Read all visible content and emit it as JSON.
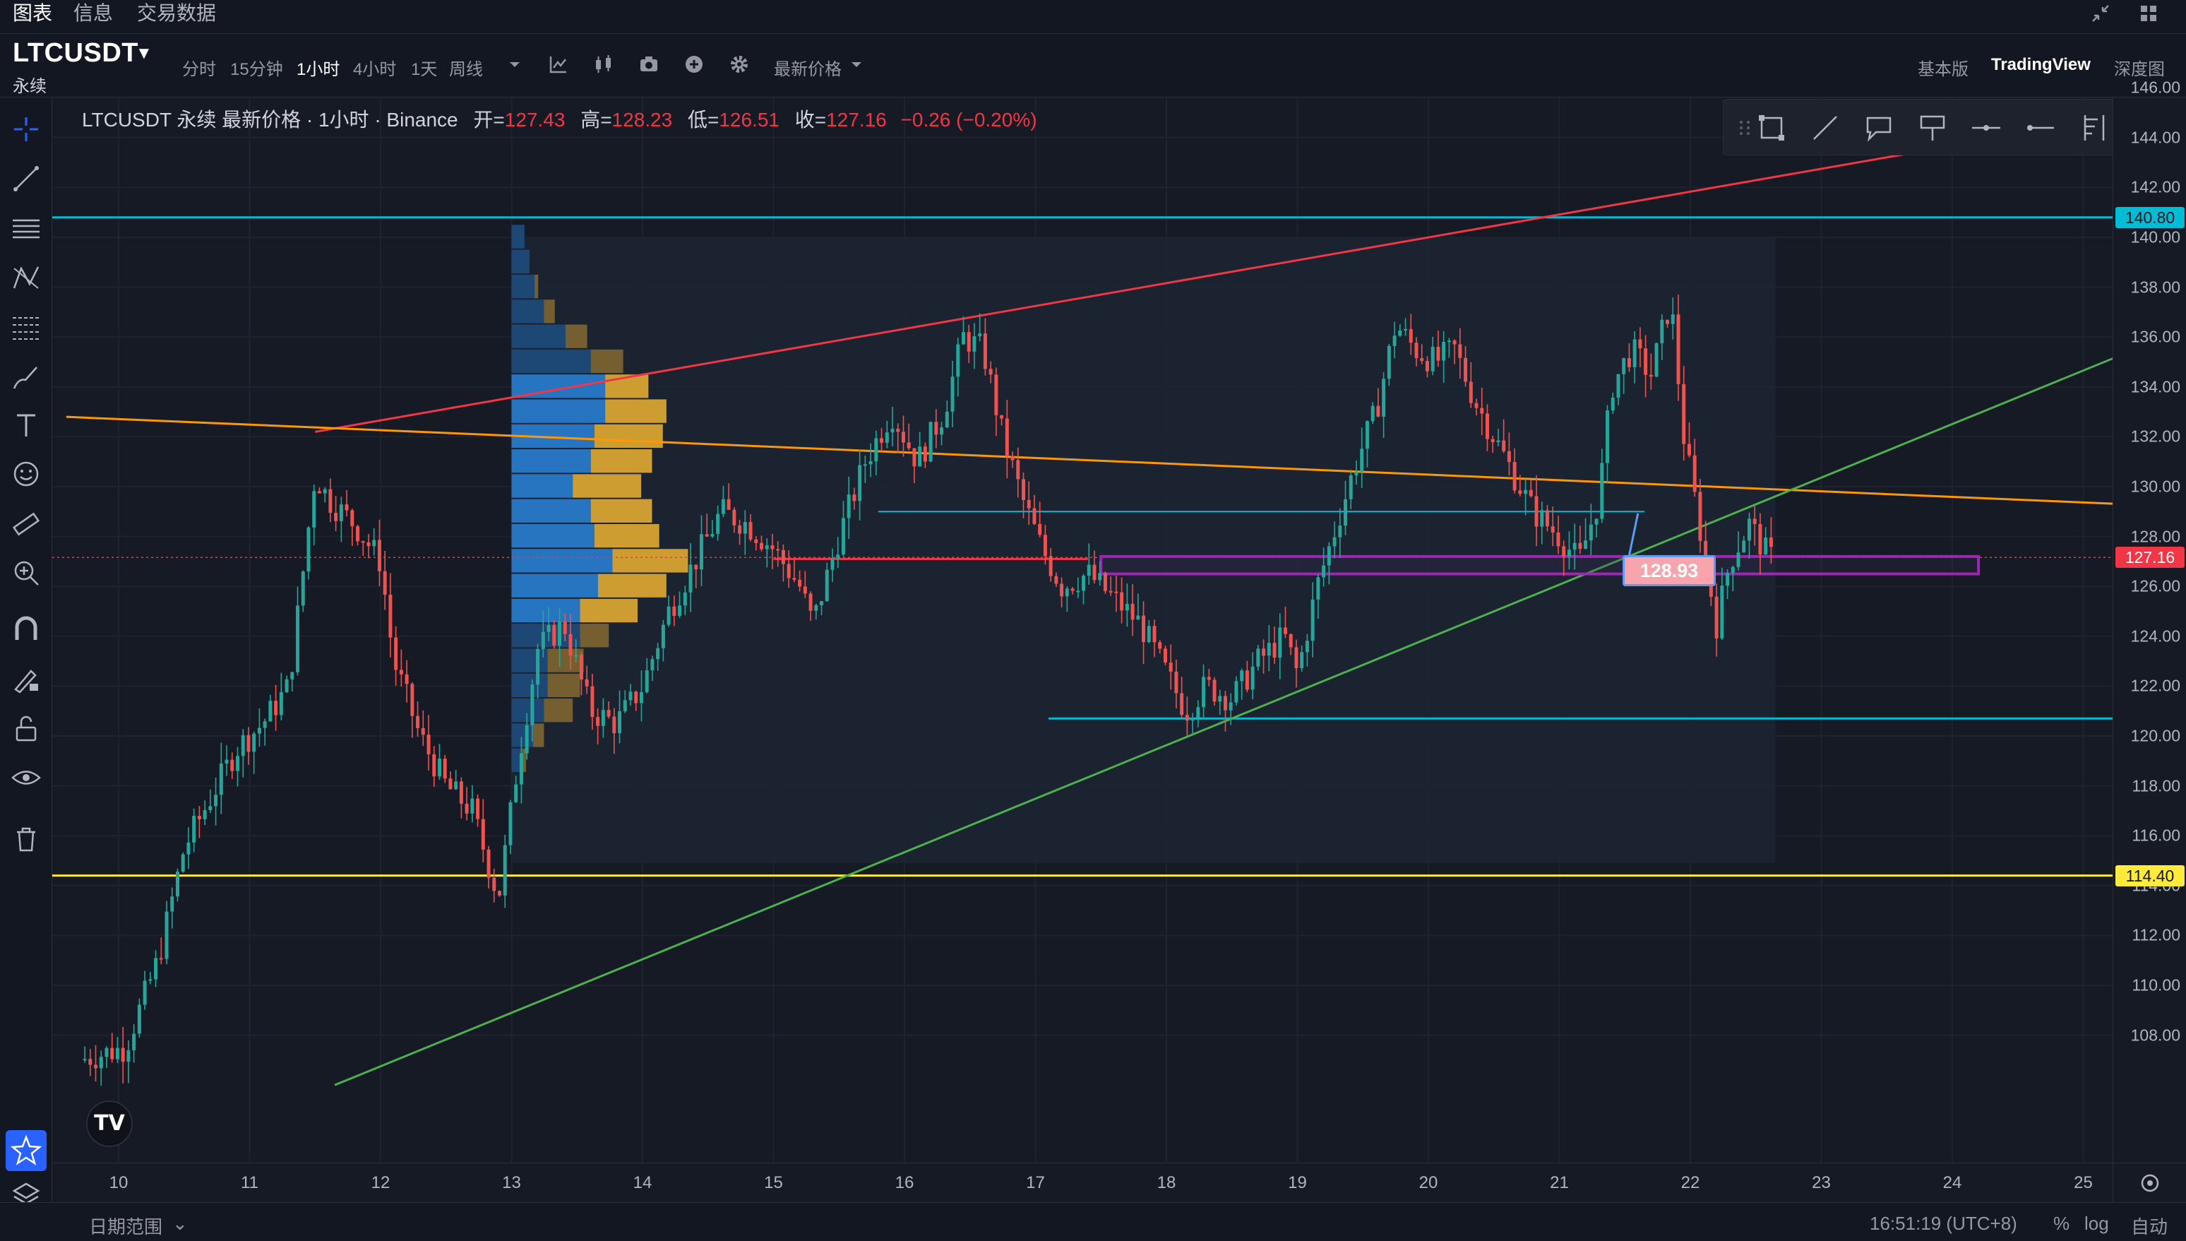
{
  "top_tabs": [
    {
      "label": "图表",
      "active": true
    },
    {
      "label": "信息",
      "active": false
    },
    {
      "label": "交易数据",
      "active": false
    }
  ],
  "symbol": {
    "name": "LTCUSDT",
    "contract": "永续"
  },
  "timeframes": [
    {
      "label": "分时",
      "active": false
    },
    {
      "label": "15分钟",
      "active": false
    },
    {
      "label": "1小时",
      "active": true
    },
    {
      "label": "4小时",
      "active": false
    },
    {
      "label": "1天",
      "active": false
    },
    {
      "label": "周线",
      "active": false
    }
  ],
  "price_source_label": "最新价格",
  "views": [
    {
      "label": "基本版",
      "active": false
    },
    {
      "label": "TradingView",
      "active": true
    },
    {
      "label": "深度图",
      "active": false
    }
  ],
  "legend": {
    "title": "LTCUSDT 永续 最新价格 · 1小时 · Binance",
    "open_label": "开=",
    "open": "127.43",
    "high_label": "高=",
    "high": "128.23",
    "low_label": "低=",
    "low": "126.51",
    "close_label": "收=",
    "close": "127.16",
    "change": "−0.26 (−0.20%)"
  },
  "price_axis": {
    "ticks": [
      "146.00",
      "144.00",
      "142.00",
      "140.00",
      "138.00",
      "136.00",
      "134.00",
      "132.00",
      "130.00",
      "128.00",
      "126.00",
      "124.00",
      "122.00",
      "120.00",
      "118.00",
      "116.00",
      "114.00",
      "112.00",
      "110.00",
      "108.00"
    ],
    "badges": [
      {
        "label": "140.80",
        "value": 140.8,
        "bg": "#00bcd4",
        "fg": "#131722"
      },
      {
        "label": "127.16",
        "value": 127.16,
        "bg": "#f23645",
        "fg": "#ffffff"
      },
      {
        "label": "114.40",
        "value": 114.4,
        "bg": "#ffeb3b",
        "fg": "#131722"
      }
    ]
  },
  "time_axis": {
    "ticks": [
      "10",
      "11",
      "12",
      "13",
      "14",
      "15",
      "16",
      "17",
      "18",
      "19",
      "20",
      "21",
      "22",
      "23",
      "24",
      "25"
    ]
  },
  "callout": {
    "label": "128.93"
  },
  "footer": {
    "date_range": "日期范围",
    "time": "16:51:19 (UTC+8)",
    "percent": "%",
    "log": "log",
    "auto": "自动"
  },
  "colors": {
    "up": "#26a69a",
    "down": "#ef5350",
    "cyan": "#00bcd4",
    "yellow": "#ffeb3b",
    "red_line": "#f23645",
    "orange_line": "#ff9800",
    "green_line": "#4caf50",
    "purple_box": "#9c27b0",
    "volume_blue": "#2196f3",
    "volume_gold": "#f0b429"
  }
}
